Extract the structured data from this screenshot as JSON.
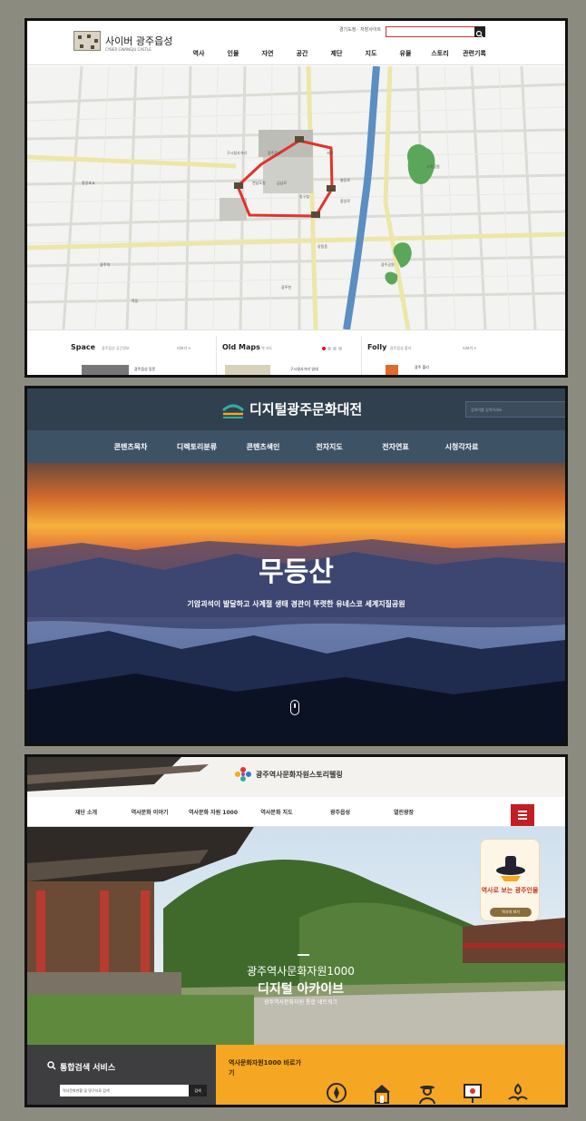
{
  "panel1": {
    "logo_text": "사이버 광주읍성",
    "logo_sub": "CYBER GWANGJU CASTLE",
    "util_links": "경기도청 · 저장사이트",
    "nav": [
      "역사",
      "인물",
      "자연",
      "공간",
      "제단",
      "지도",
      "유물",
      "스토리",
      "관련기록"
    ],
    "map_labels": [
      "광주읍성",
      "광주천",
      "사직공원",
      "중앙초교",
      "광주역",
      "구시청사거리",
      "전남도청",
      "충장로",
      "금남로",
      "동구청",
      "서원",
      "중앙로",
      "양림동",
      "학동",
      "광주공원"
    ],
    "sections": [
      {
        "title": "Space",
        "sub": "광주읍성 공간정보",
        "more": "더보기 +"
      },
      {
        "title": "Old Maps",
        "sub": "옛 지도",
        "more": ""
      },
      {
        "title": "Folly",
        "sub": "광주읍성 폴리",
        "more": "더보기 +"
      }
    ],
    "section_items": [
      "광주읍성 동문",
      "구시청사거리 일대",
      "광주 폴리"
    ]
  },
  "panel2": {
    "site_title": "디지털광주문화대전",
    "search_placeholder": "검색어를 입력하세요",
    "nav": [
      "콘텐츠목차",
      "디렉토리분류",
      "콘텐츠색인",
      "전자지도",
      "전자연표",
      "시청각자료"
    ],
    "hero_title": "무등산",
    "hero_subtitle": "기암괴석이 발달하고 사계절 생태 경관이 뚜렷한 유네스코 세계지질공원"
  },
  "panel3": {
    "logo_text": "광주역사문화자원스토리텔링",
    "nav": [
      "재단 소개",
      "역사문화 이야기",
      "역사문화 자원 1000",
      "역사문화 지도",
      "광주읍성",
      "열린광장"
    ],
    "hero_line1": "광주역사문화자원1000",
    "hero_line2": "디지털 아카이브",
    "hero_line3": "광주역사문화자원 통합 네트워크",
    "card_title": "역사로 보는 광주인물",
    "card_button": "역사의 보기",
    "search_title": "통합검색 서비스",
    "search_placeholder": "역사문화현황 및 명구자료 검색",
    "search_button": "검색",
    "shortcut_title": "역사문화자원1000 바로가기",
    "icons": [
      "compass-icon",
      "building-icon",
      "person-icon",
      "presentation-icon",
      "hands-icon"
    ]
  },
  "colors": {
    "map_route": "#e2332b",
    "river": "#5b8ec2",
    "park": "#5aa75a",
    "orange": "#f5a623",
    "menu_red": "#c41e24",
    "teal": "#2bb0a0"
  }
}
